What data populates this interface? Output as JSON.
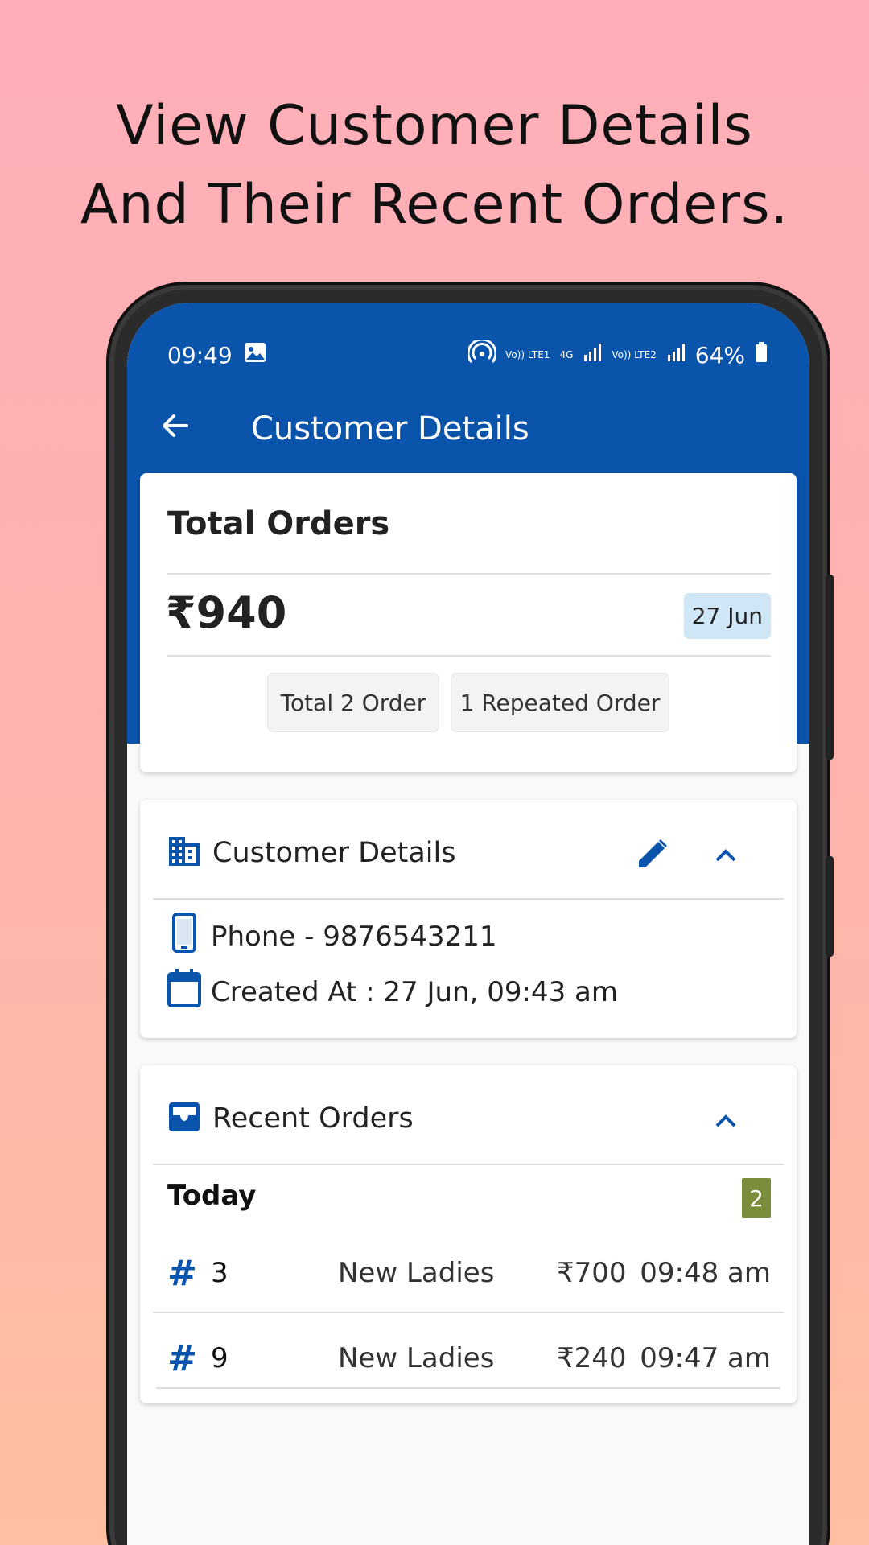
{
  "headline": {
    "line1": "View Customer Details",
    "line2": "And Their Recent Orders."
  },
  "status_bar": {
    "time": "09:49",
    "battery": "64%",
    "network1": "Vo)) LTE1",
    "network_type": "4G",
    "network2": "Vo)) LTE2"
  },
  "toolbar": {
    "title": "Customer Details"
  },
  "total_orders": {
    "heading": "Total Orders",
    "amount": "₹940",
    "date": "27 Jun",
    "chip_total": "Total 2 Order",
    "chip_repeated": "1 Repeated Order"
  },
  "customer_details": {
    "heading": "Customer Details",
    "phone": "Phone - 9876543211",
    "created_at": "Created At : 27 Jun, 09:43 am"
  },
  "recent_orders": {
    "heading": "Recent Orders",
    "group_label": "Today",
    "group_count": "2",
    "orders": [
      {
        "hash": "#",
        "number": "3",
        "category": "New Ladies",
        "amount": "₹700",
        "time": "09:48 am"
      },
      {
        "hash": "#",
        "number": "9",
        "category": "New Ladies",
        "amount": "₹240",
        "time": "09:47 am"
      }
    ]
  },
  "colors": {
    "primary": "#0a54ac",
    "count_badge": "#7a8d3a",
    "date_badge": "#cfe6f7"
  }
}
